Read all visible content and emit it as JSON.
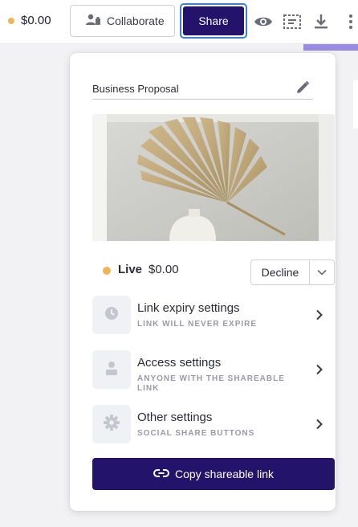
{
  "topbar": {
    "amount": "$0.00",
    "collaborate_label": "Collaborate",
    "share_label": "Share",
    "icons": [
      "user-group-icon",
      "eye-icon",
      "variables-icon",
      "download-icon",
      "more-vertical-icon"
    ]
  },
  "panel": {
    "document_title": "Business Proposal",
    "status": {
      "label": "Live",
      "amount": "$0.00",
      "decline_label": "Decline"
    },
    "settings": [
      {
        "title": "Link expiry settings",
        "subtitle": "LINK WILL NEVER EXPIRE",
        "icon": "clock-icon"
      },
      {
        "title": "Access settings",
        "subtitle": "ANYONE WITH THE SHAREABLE LINK",
        "icon": "person-icon"
      },
      {
        "title": "Other settings",
        "subtitle": "SOCIAL SHARE BUTTONS",
        "icon": "gear-icon"
      }
    ],
    "copy_label": "Copy shareable link"
  },
  "colors": {
    "brand": "#23136b",
    "focus_ring": "#3b82d6",
    "status_dot": "#f2b35a"
  }
}
